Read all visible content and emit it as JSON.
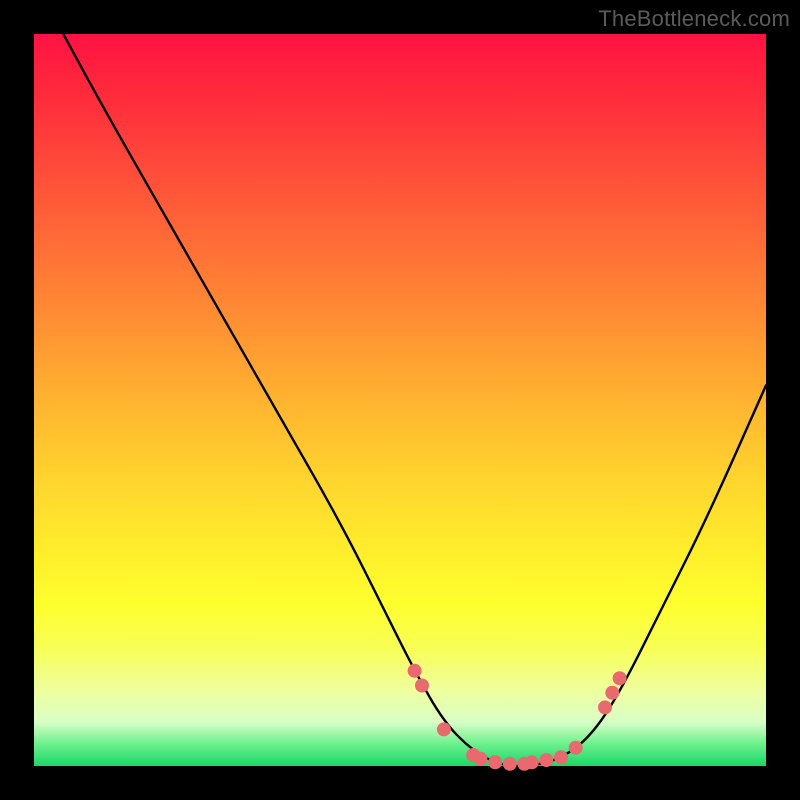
{
  "watermark": "TheBottleneck.com",
  "chart_data": {
    "type": "line",
    "title": "",
    "xlabel": "",
    "ylabel": "",
    "xlim": [
      0,
      100
    ],
    "ylim": [
      0,
      100
    ],
    "series": [
      {
        "name": "bottleneck-curve",
        "x": [
          4,
          10,
          18,
          26,
          34,
          42,
          48,
          52,
          56,
          60,
          64,
          68,
          72,
          76,
          80,
          86,
          92,
          100
        ],
        "y": [
          100,
          89,
          75,
          61,
          47,
          33,
          21,
          13,
          6,
          2,
          0,
          0,
          1,
          4,
          10,
          22,
          34,
          52
        ]
      }
    ],
    "markers": {
      "name": "highlight-dots",
      "color": "#e86a6e",
      "x": [
        52,
        53,
        56,
        60,
        61,
        63,
        65,
        67,
        68,
        70,
        72,
        74,
        78,
        79,
        80
      ],
      "y": [
        13,
        11,
        5,
        1.5,
        1,
        0.5,
        0.3,
        0.3,
        0.5,
        0.8,
        1.2,
        2.5,
        8,
        10,
        12
      ]
    },
    "gradient_stops": [
      {
        "pct": 0,
        "color": "#ff1242"
      },
      {
        "pct": 50,
        "color": "#ffb330"
      },
      {
        "pct": 80,
        "color": "#feff2e"
      },
      {
        "pct": 100,
        "color": "#1ad76a"
      }
    ]
  }
}
